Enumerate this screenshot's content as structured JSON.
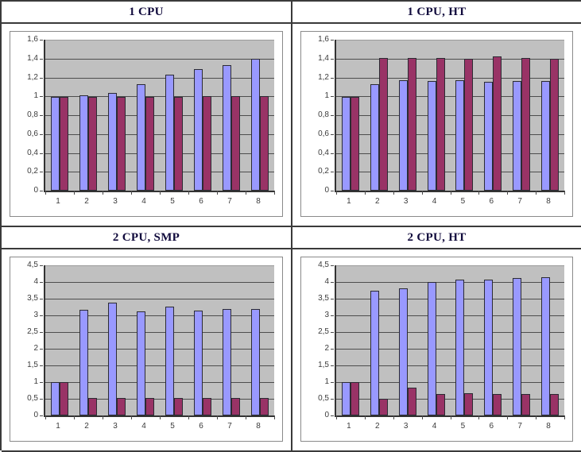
{
  "page": {
    "kind": "four-panel-bar-chart-figure",
    "panel_count": 4
  },
  "colors": {
    "series0": "#9999ff",
    "series1": "#993366",
    "plot_background": "#c0c0c0",
    "gridline": "#4d4d4d",
    "border": "#3a3a3a",
    "title_text": "#100a3c",
    "tick_text": "#3b3b3b",
    "page_background": "#ffffff"
  },
  "panels": [
    {
      "id": "panel-1-cpu",
      "title": "1 CPU",
      "chart_data": {
        "type": "bar",
        "title": "1 CPU",
        "xlabel": "",
        "ylabel": "",
        "categories": [
          "1",
          "2",
          "3",
          "4",
          "5",
          "6",
          "7",
          "8"
        ],
        "xticklabels": [
          "1",
          "2",
          "3",
          "4",
          "5",
          "6",
          "7",
          "8"
        ],
        "yticklabels": [
          "0",
          "0,2",
          "0,4",
          "0,6",
          "0,8",
          "1",
          "1,2",
          "1,4",
          "1,6"
        ],
        "ytickvalues": [
          0,
          0.2,
          0.4,
          0.6,
          0.8,
          1.0,
          1.2,
          1.4,
          1.6
        ],
        "ylim": [
          0,
          1.6
        ],
        "grid": true,
        "legend": "none",
        "series": [
          {
            "name": "series-1",
            "color": "#9999ff",
            "values": [
              0.99,
              1.01,
              1.04,
              1.13,
              1.23,
              1.29,
              1.33,
              1.4
            ]
          },
          {
            "name": "series-2",
            "color": "#993366",
            "values": [
              0.99,
              0.99,
              0.99,
              0.99,
              0.99,
              1.0,
              1.0,
              1.0
            ]
          }
        ]
      }
    },
    {
      "id": "panel-1-cpu-ht",
      "title": "1 CPU, HT",
      "chart_data": {
        "type": "bar",
        "title": "1 CPU, HT",
        "xlabel": "",
        "ylabel": "",
        "categories": [
          "1",
          "2",
          "3",
          "4",
          "5",
          "6",
          "7",
          "8"
        ],
        "xticklabels": [
          "1",
          "2",
          "3",
          "4",
          "5",
          "6",
          "7",
          "8"
        ],
        "yticklabels": [
          "0",
          "0,2",
          "0,4",
          "0,6",
          "0,8",
          "1",
          "1,2",
          "1,4",
          "1,6"
        ],
        "ytickvalues": [
          0,
          0.2,
          0.4,
          0.6,
          0.8,
          1.0,
          1.2,
          1.4,
          1.6
        ],
        "ylim": [
          0,
          1.6
        ],
        "grid": true,
        "legend": "none",
        "series": [
          {
            "name": "series-1",
            "color": "#9999ff",
            "values": [
              0.99,
              1.13,
              1.17,
              1.16,
              1.17,
              1.15,
              1.16,
              1.16
            ]
          },
          {
            "name": "series-2",
            "color": "#993366",
            "values": [
              0.99,
              1.41,
              1.41,
              1.41,
              1.4,
              1.42,
              1.41,
              1.4
            ]
          }
        ]
      }
    },
    {
      "id": "panel-2-cpu-smp",
      "title": "2 CPU, SMP",
      "chart_data": {
        "type": "bar",
        "title": "2 CPU, SMP",
        "xlabel": "",
        "ylabel": "",
        "categories": [
          "1",
          "2",
          "3",
          "4",
          "5",
          "6",
          "7",
          "8"
        ],
        "xticklabels": [
          "1",
          "2",
          "3",
          "4",
          "5",
          "6",
          "7",
          "8"
        ],
        "yticklabels": [
          "0",
          "0,5",
          "1",
          "1,5",
          "2",
          "2,5",
          "3",
          "3,5",
          "4",
          "4,5"
        ],
        "ytickvalues": [
          0,
          0.5,
          1.0,
          1.5,
          2.0,
          2.5,
          3.0,
          3.5,
          4.0,
          4.5
        ],
        "ylim": [
          0,
          4.5
        ],
        "grid": true,
        "legend": "none",
        "series": [
          {
            "name": "series-1",
            "color": "#9999ff",
            "values": [
              0.99,
              3.17,
              3.38,
              3.13,
              3.26,
              3.14,
              3.2,
              3.18
            ]
          },
          {
            "name": "series-2",
            "color": "#993366",
            "values": [
              0.99,
              0.52,
              0.52,
              0.52,
              0.52,
              0.52,
              0.52,
              0.52
            ]
          }
        ]
      }
    },
    {
      "id": "panel-2-cpu-ht",
      "title": "2 CPU, HT",
      "chart_data": {
        "type": "bar",
        "title": "2 CPU, HT",
        "xlabel": "",
        "ylabel": "",
        "categories": [
          "1",
          "2",
          "3",
          "4",
          "5",
          "6",
          "7",
          "8"
        ],
        "xticklabels": [
          "1",
          "2",
          "3",
          "4",
          "5",
          "6",
          "7",
          "8"
        ],
        "yticklabels": [
          "0",
          "0,5",
          "1",
          "1,5",
          "2",
          "2,5",
          "3",
          "3,5",
          "4",
          "4,5"
        ],
        "ytickvalues": [
          0,
          0.5,
          1.0,
          1.5,
          2.0,
          2.5,
          3.0,
          3.5,
          4.0,
          4.5
        ],
        "ylim": [
          0,
          4.5
        ],
        "grid": true,
        "legend": "none",
        "series": [
          {
            "name": "series-1",
            "color": "#9999ff",
            "values": [
              0.99,
              3.75,
              3.8,
              3.99,
              4.06,
              4.06,
              4.11,
              4.14
            ]
          },
          {
            "name": "series-2",
            "color": "#993366",
            "values": [
              0.99,
              0.49,
              0.83,
              0.64,
              0.67,
              0.64,
              0.64,
              0.64
            ]
          }
        ]
      }
    }
  ]
}
